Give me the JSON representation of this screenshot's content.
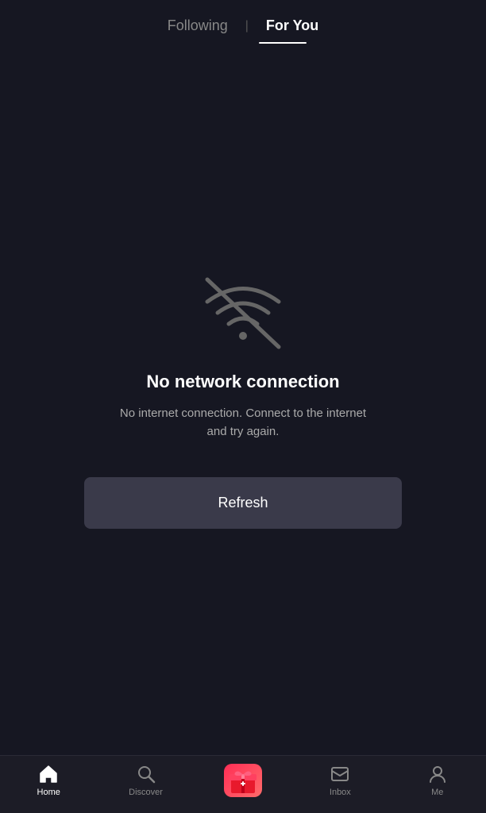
{
  "header": {
    "following_label": "Following",
    "for_you_label": "For You",
    "divider": "|"
  },
  "error": {
    "title": "No network connection",
    "subtitle": "No internet connection. Connect to the internet and try again."
  },
  "refresh_button": {
    "label": "Refresh"
  },
  "bottom_nav": {
    "items": [
      {
        "id": "home",
        "label": "Home",
        "active": true
      },
      {
        "id": "discover",
        "label": "Discover",
        "active": false
      },
      {
        "id": "add",
        "label": "",
        "active": false
      },
      {
        "id": "inbox",
        "label": "Inbox",
        "active": false
      },
      {
        "id": "me",
        "label": "Me",
        "active": false
      }
    ]
  }
}
